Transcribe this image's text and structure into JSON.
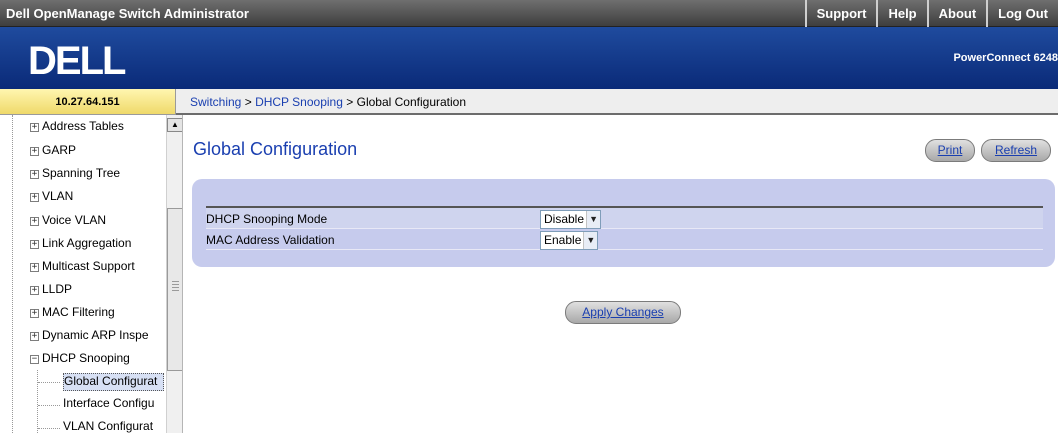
{
  "header": {
    "app_title": "Dell OpenManage Switch Administrator",
    "nav": [
      "Support",
      "Help",
      "About",
      "Log Out"
    ],
    "logo_text": "DELL",
    "model": "PowerConnect 6248"
  },
  "ip_address": "10.27.64.151",
  "breadcrumb": {
    "items": [
      "Switching",
      "DHCP Snooping",
      "Global Configuration"
    ],
    "separator": ">"
  },
  "sidebar": {
    "items": [
      {
        "label": "Address Tables",
        "expander": "+"
      },
      {
        "label": "GARP",
        "expander": "+"
      },
      {
        "label": "Spanning Tree",
        "expander": "+"
      },
      {
        "label": "VLAN",
        "expander": "+"
      },
      {
        "label": "Voice VLAN",
        "expander": "+"
      },
      {
        "label": "Link Aggregation",
        "expander": "+"
      },
      {
        "label": "Multicast Support",
        "expander": "+"
      },
      {
        "label": "LLDP",
        "expander": "+"
      },
      {
        "label": "MAC Filtering",
        "expander": "+"
      },
      {
        "label": "Dynamic ARP Inspe",
        "expander": "+"
      },
      {
        "label": "DHCP Snooping",
        "expander": "−"
      }
    ],
    "children": [
      {
        "label": "Global Configurat",
        "selected": true
      },
      {
        "label": "Interface Configu",
        "selected": false
      },
      {
        "label": "VLAN Configurat",
        "selected": false
      }
    ]
  },
  "main": {
    "title": "Global Configuration",
    "print_label": "Print",
    "refresh_label": "Refresh",
    "fields": [
      {
        "label": "DHCP Snooping Mode",
        "value": "Disable"
      },
      {
        "label": "MAC Address Validation",
        "value": "Enable"
      }
    ],
    "apply_label": "Apply Changes"
  },
  "colors": {
    "banner": "#0a2a78",
    "link": "#1a3fb0",
    "panel": "#c6cbed",
    "ip_panel": "#efd96a"
  }
}
